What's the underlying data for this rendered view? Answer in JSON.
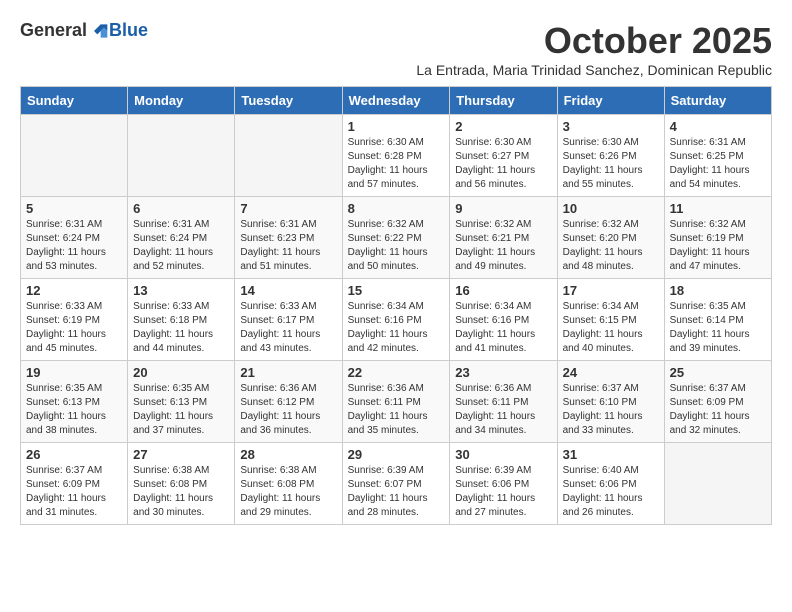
{
  "header": {
    "logo_general": "General",
    "logo_blue": "Blue",
    "month_title": "October 2025",
    "subtitle": "La Entrada, Maria Trinidad Sanchez, Dominican Republic"
  },
  "weekdays": [
    "Sunday",
    "Monday",
    "Tuesday",
    "Wednesday",
    "Thursday",
    "Friday",
    "Saturday"
  ],
  "weeks": [
    [
      {
        "day": "",
        "sunrise": "",
        "sunset": "",
        "daylight": "",
        "empty": true
      },
      {
        "day": "",
        "sunrise": "",
        "sunset": "",
        "daylight": "",
        "empty": true
      },
      {
        "day": "",
        "sunrise": "",
        "sunset": "",
        "daylight": "",
        "empty": true
      },
      {
        "day": "1",
        "sunrise": "Sunrise: 6:30 AM",
        "sunset": "Sunset: 6:28 PM",
        "daylight": "Daylight: 11 hours and 57 minutes.",
        "empty": false
      },
      {
        "day": "2",
        "sunrise": "Sunrise: 6:30 AM",
        "sunset": "Sunset: 6:27 PM",
        "daylight": "Daylight: 11 hours and 56 minutes.",
        "empty": false
      },
      {
        "day": "3",
        "sunrise": "Sunrise: 6:30 AM",
        "sunset": "Sunset: 6:26 PM",
        "daylight": "Daylight: 11 hours and 55 minutes.",
        "empty": false
      },
      {
        "day": "4",
        "sunrise": "Sunrise: 6:31 AM",
        "sunset": "Sunset: 6:25 PM",
        "daylight": "Daylight: 11 hours and 54 minutes.",
        "empty": false
      }
    ],
    [
      {
        "day": "5",
        "sunrise": "Sunrise: 6:31 AM",
        "sunset": "Sunset: 6:24 PM",
        "daylight": "Daylight: 11 hours and 53 minutes.",
        "empty": false
      },
      {
        "day": "6",
        "sunrise": "Sunrise: 6:31 AM",
        "sunset": "Sunset: 6:24 PM",
        "daylight": "Daylight: 11 hours and 52 minutes.",
        "empty": false
      },
      {
        "day": "7",
        "sunrise": "Sunrise: 6:31 AM",
        "sunset": "Sunset: 6:23 PM",
        "daylight": "Daylight: 11 hours and 51 minutes.",
        "empty": false
      },
      {
        "day": "8",
        "sunrise": "Sunrise: 6:32 AM",
        "sunset": "Sunset: 6:22 PM",
        "daylight": "Daylight: 11 hours and 50 minutes.",
        "empty": false
      },
      {
        "day": "9",
        "sunrise": "Sunrise: 6:32 AM",
        "sunset": "Sunset: 6:21 PM",
        "daylight": "Daylight: 11 hours and 49 minutes.",
        "empty": false
      },
      {
        "day": "10",
        "sunrise": "Sunrise: 6:32 AM",
        "sunset": "Sunset: 6:20 PM",
        "daylight": "Daylight: 11 hours and 48 minutes.",
        "empty": false
      },
      {
        "day": "11",
        "sunrise": "Sunrise: 6:32 AM",
        "sunset": "Sunset: 6:19 PM",
        "daylight": "Daylight: 11 hours and 47 minutes.",
        "empty": false
      }
    ],
    [
      {
        "day": "12",
        "sunrise": "Sunrise: 6:33 AM",
        "sunset": "Sunset: 6:19 PM",
        "daylight": "Daylight: 11 hours and 45 minutes.",
        "empty": false
      },
      {
        "day": "13",
        "sunrise": "Sunrise: 6:33 AM",
        "sunset": "Sunset: 6:18 PM",
        "daylight": "Daylight: 11 hours and 44 minutes.",
        "empty": false
      },
      {
        "day": "14",
        "sunrise": "Sunrise: 6:33 AM",
        "sunset": "Sunset: 6:17 PM",
        "daylight": "Daylight: 11 hours and 43 minutes.",
        "empty": false
      },
      {
        "day": "15",
        "sunrise": "Sunrise: 6:34 AM",
        "sunset": "Sunset: 6:16 PM",
        "daylight": "Daylight: 11 hours and 42 minutes.",
        "empty": false
      },
      {
        "day": "16",
        "sunrise": "Sunrise: 6:34 AM",
        "sunset": "Sunset: 6:16 PM",
        "daylight": "Daylight: 11 hours and 41 minutes.",
        "empty": false
      },
      {
        "day": "17",
        "sunrise": "Sunrise: 6:34 AM",
        "sunset": "Sunset: 6:15 PM",
        "daylight": "Daylight: 11 hours and 40 minutes.",
        "empty": false
      },
      {
        "day": "18",
        "sunrise": "Sunrise: 6:35 AM",
        "sunset": "Sunset: 6:14 PM",
        "daylight": "Daylight: 11 hours and 39 minutes.",
        "empty": false
      }
    ],
    [
      {
        "day": "19",
        "sunrise": "Sunrise: 6:35 AM",
        "sunset": "Sunset: 6:13 PM",
        "daylight": "Daylight: 11 hours and 38 minutes.",
        "empty": false
      },
      {
        "day": "20",
        "sunrise": "Sunrise: 6:35 AM",
        "sunset": "Sunset: 6:13 PM",
        "daylight": "Daylight: 11 hours and 37 minutes.",
        "empty": false
      },
      {
        "day": "21",
        "sunrise": "Sunrise: 6:36 AM",
        "sunset": "Sunset: 6:12 PM",
        "daylight": "Daylight: 11 hours and 36 minutes.",
        "empty": false
      },
      {
        "day": "22",
        "sunrise": "Sunrise: 6:36 AM",
        "sunset": "Sunset: 6:11 PM",
        "daylight": "Daylight: 11 hours and 35 minutes.",
        "empty": false
      },
      {
        "day": "23",
        "sunrise": "Sunrise: 6:36 AM",
        "sunset": "Sunset: 6:11 PM",
        "daylight": "Daylight: 11 hours and 34 minutes.",
        "empty": false
      },
      {
        "day": "24",
        "sunrise": "Sunrise: 6:37 AM",
        "sunset": "Sunset: 6:10 PM",
        "daylight": "Daylight: 11 hours and 33 minutes.",
        "empty": false
      },
      {
        "day": "25",
        "sunrise": "Sunrise: 6:37 AM",
        "sunset": "Sunset: 6:09 PM",
        "daylight": "Daylight: 11 hours and 32 minutes.",
        "empty": false
      }
    ],
    [
      {
        "day": "26",
        "sunrise": "Sunrise: 6:37 AM",
        "sunset": "Sunset: 6:09 PM",
        "daylight": "Daylight: 11 hours and 31 minutes.",
        "empty": false
      },
      {
        "day": "27",
        "sunrise": "Sunrise: 6:38 AM",
        "sunset": "Sunset: 6:08 PM",
        "daylight": "Daylight: 11 hours and 30 minutes.",
        "empty": false
      },
      {
        "day": "28",
        "sunrise": "Sunrise: 6:38 AM",
        "sunset": "Sunset: 6:08 PM",
        "daylight": "Daylight: 11 hours and 29 minutes.",
        "empty": false
      },
      {
        "day": "29",
        "sunrise": "Sunrise: 6:39 AM",
        "sunset": "Sunset: 6:07 PM",
        "daylight": "Daylight: 11 hours and 28 minutes.",
        "empty": false
      },
      {
        "day": "30",
        "sunrise": "Sunrise: 6:39 AM",
        "sunset": "Sunset: 6:06 PM",
        "daylight": "Daylight: 11 hours and 27 minutes.",
        "empty": false
      },
      {
        "day": "31",
        "sunrise": "Sunrise: 6:40 AM",
        "sunset": "Sunset: 6:06 PM",
        "daylight": "Daylight: 11 hours and 26 minutes.",
        "empty": false
      },
      {
        "day": "",
        "sunrise": "",
        "sunset": "",
        "daylight": "",
        "empty": true
      }
    ]
  ]
}
